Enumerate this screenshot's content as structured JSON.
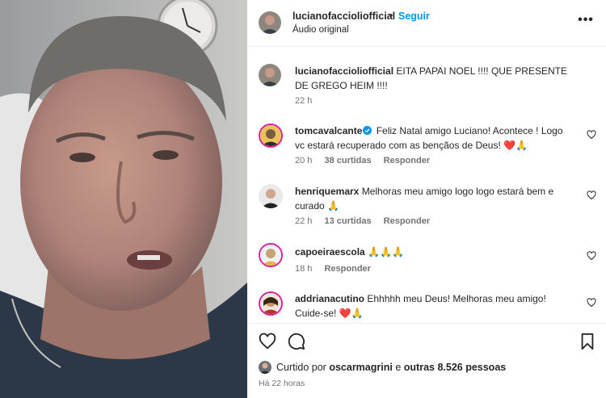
{
  "post": {
    "username": "lucianofaccioliofficial",
    "separator": "•",
    "follow_label": "Seguir",
    "audio_label": "Áudio original",
    "more_icon": "more-horizontal-icon"
  },
  "caption": {
    "username": "lucianofaccioliofficial",
    "text": "EITA PAPAI NOEL !!!! QUE PRESENTE DE GREGO HEIM !!!!",
    "time": "22 h"
  },
  "comments": [
    {
      "username": "tomcavalcante",
      "verified": true,
      "text": "Feliz Natal amigo Luciano! Acontece ! Logo vc estará recuperado com as bençãos de Deus! ❤️🙏",
      "time": "20 h",
      "likes": "38 curtidas",
      "reply": "Responder"
    },
    {
      "username": "henriquemarx",
      "verified": false,
      "text": "Melhoras meu amigo logo logo estará bem e curado 🙏",
      "time": "22 h",
      "likes": "13 curtidas",
      "reply": "Responder"
    },
    {
      "username": "capoeiraescola",
      "verified": false,
      "text": "🙏🙏🙏",
      "time": "18 h",
      "likes": "",
      "reply": "Responder"
    },
    {
      "username": "addrianacutino",
      "verified": false,
      "text": "Ehhhhh meu Deus! Melhoras meu amigo! Cuide-se! ❤️🙏",
      "time": "",
      "likes": "",
      "reply": ""
    }
  ],
  "footer": {
    "liked_prefix": "Curtido por",
    "liked_user": "oscarmagrini",
    "liked_middle": "e",
    "liked_others": "outras 8.526 pessoas",
    "time": "Há 22 horas"
  },
  "icons": {
    "like": "heart-icon",
    "comment": "comment-icon",
    "save": "bookmark-icon",
    "verified": "verified-badge-icon"
  },
  "colors": {
    "accent": "#0095f6",
    "text": "#262626",
    "secondary": "#737373",
    "verified": "#0095f6"
  }
}
